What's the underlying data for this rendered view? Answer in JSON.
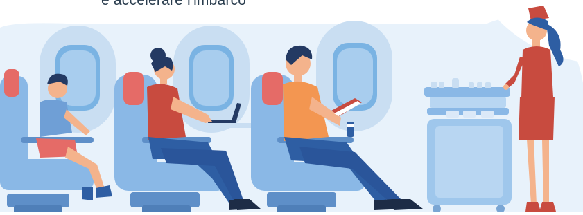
{
  "caption": {
    "text": "e accelerare l'imbarco"
  },
  "colors": {
    "cabin_bg": "#e8f2fb",
    "window_frame": "#c9def2",
    "window_glass": "#7ab3e3",
    "seat": "#8ab8e6",
    "seat_dark": "#5e8fc8",
    "headrest": "#e56b67",
    "uniform_red": "#c84b3f",
    "jeans": "#2e5ea3",
    "orange_shirt": "#f39651",
    "trolley": "#9fc7ec"
  },
  "scene": {
    "subjects": [
      "boy-passenger",
      "woman-with-laptop",
      "man-with-book",
      "flight-attendant",
      "service-trolley"
    ],
    "icons": [
      "airplane-window",
      "passenger-seat",
      "laptop",
      "book",
      "drink-can"
    ]
  }
}
